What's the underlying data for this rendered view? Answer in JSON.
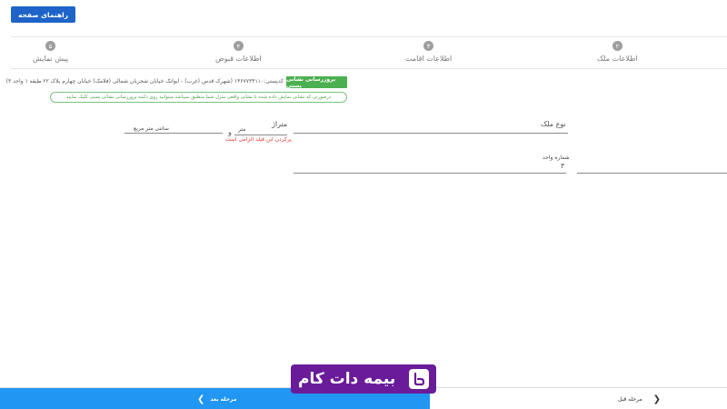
{
  "header": {
    "help_label": "راهنمای صفحه"
  },
  "stepper": {
    "steps": [
      {
        "number": "۲",
        "label": "اطلاعات ملک"
      },
      {
        "number": "۳",
        "label": "اطلاعات اقامت"
      },
      {
        "number": "۴",
        "label": "اطلاعات قبوض"
      },
      {
        "number": "۵",
        "label": "پیش نمایش"
      }
    ]
  },
  "postal": {
    "update_label": "بروزرسانی نشانی پستی",
    "address": "کدپستی:۱۴۶۷۷۳۴۱۱۰ (شهرک قدس (غرب) - ایوانک خیابان شجریان شمالی (فلامک) خیابان چهارم پلاک ۲۲ طبقه ۱ واحد ۳)",
    "notice": "درصورتی که نشانی نمایش داده شده با نشانی واقعی منزل شما منطبق نمیباشد میتوانید روی دکمه بروزرسانی نشانی پستی کلیک نمایید"
  },
  "form": {
    "property_type_label": "نوع ملک",
    "area_label": "متراژ",
    "meter_label": "متر",
    "and_label": "و",
    "cm_label": "سانتی متر مربع",
    "required_error": "پرکردن این فیلد الزامی است",
    "unit_number_label": "شماره واحد",
    "unit_number_value": "۳"
  },
  "footer": {
    "next_label": "مرحله بعد",
    "prev_label": "مرحله قبل"
  },
  "logo": {
    "text": "بیمه دات کام"
  },
  "colors": {
    "primary": "#1e64c8",
    "next": "#2196f3",
    "success": "#4caf50",
    "error": "#e53935",
    "step": "#9e9e9e",
    "logo_bg": "#6a1b9a"
  }
}
